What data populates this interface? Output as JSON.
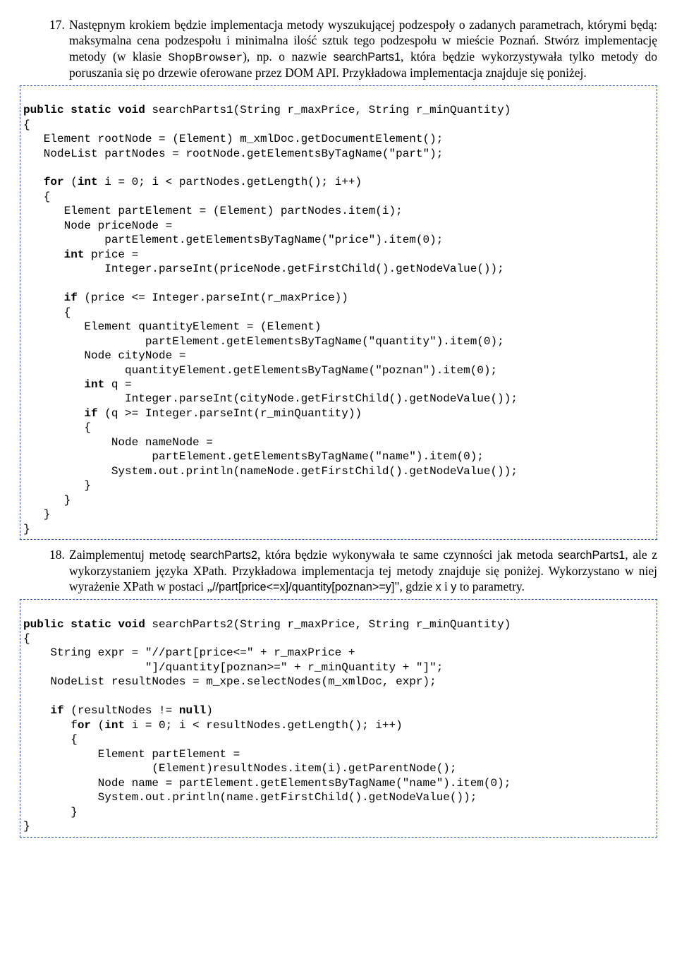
{
  "item17": {
    "num": "17.",
    "p1a": "Następnym krokiem będzie implementacja metody wyszukującej podzespoły o zadanych parametrach, którymi będą: maksymalna cena podzespołu i minimalna ilość sztuk tego podzespołu w mieście Poznań. Stwórz implementację metody (w klasie ",
    "p1b": "ShopBrowser",
    "p1c": "), np. o nazwie ",
    "p1d": "searchParts1",
    "p1e": ", która będzie wykorzystywała tylko metody do poruszania się po drzewie oferowane przez DOM API. Przykładowa implementacja znajduje się poniżej."
  },
  "code1": {
    "l01a": "public static void",
    "l01b": " searchParts1(String r_maxPrice, String r_minQuantity)",
    "l02": "{",
    "l03": "   Element rootNode = (Element) m_xmlDoc.getDocumentElement();",
    "l04": "   NodeList partNodes = rootNode.getElementsByTagName(\"part\");",
    "l05": "",
    "l06a": "   ",
    "l06b": "for",
    "l06c": " (",
    "l06d": "int",
    "l06e": " i = 0; i < partNodes.getLength(); i++)",
    "l07": "   {",
    "l08": "      Element partElement = (Element) partNodes.item(i);",
    "l09": "      Node priceNode =",
    "l10": "            partElement.getElementsByTagName(\"price\").item(0);",
    "l11a": "      ",
    "l11b": "int",
    "l11c": " price =",
    "l12": "            Integer.parseInt(priceNode.getFirstChild().getNodeValue());",
    "l13": "",
    "l14a": "      ",
    "l14b": "if",
    "l14c": " (price <= Integer.parseInt(r_maxPrice))",
    "l15": "      {",
    "l16": "         Element quantityElement = (Element)",
    "l17": "                  partElement.getElementsByTagName(\"quantity\").item(0);",
    "l18": "         Node cityNode =",
    "l19": "               quantityElement.getElementsByTagName(\"poznan\").item(0);",
    "l20a": "         ",
    "l20b": "int",
    "l20c": " q =",
    "l21": "               Integer.parseInt(cityNode.getFirstChild().getNodeValue());",
    "l22a": "         ",
    "l22b": "if",
    "l22c": " (q >= Integer.parseInt(r_minQuantity))",
    "l23": "         {",
    "l24": "             Node nameNode =",
    "l25": "                   partElement.getElementsByTagName(\"name\").item(0);",
    "l26": "             System.out.println(nameNode.getFirstChild().getNodeValue());",
    "l27": "         }",
    "l28": "      }",
    "l29": "   }",
    "l30": "}"
  },
  "item18": {
    "num": "18.",
    "p1a": "Zaimplementuj metodę ",
    "p1b": "searchParts2",
    "p1c": ", która będzie wykonywała te same czynności jak metoda ",
    "p1d": "searchParts1",
    "p1e": ", ale z wykorzystaniem języka XPath. Przykładowa implementacja tej metody znajduje się poniżej. Wykorzystano w niej wyrażenie XPath w postaci „",
    "p1f": "//part[price<=x]/quantity[poznan>=y]",
    "p1g": "\", gdzie ",
    "p1h": "x",
    "p1i": " i ",
    "p1j": "y",
    "p1k": " to parametry."
  },
  "code2": {
    "l01a": "public static void",
    "l01b": " searchParts2(String r_maxPrice, String r_minQuantity)",
    "l02": "{",
    "l03": "    String expr = \"//part[price<=\" + r_maxPrice +",
    "l04": "                  \"]/quantity[poznan>=\" + r_minQuantity + \"]\";",
    "l05": "    NodeList resultNodes = m_xpe.selectNodes(m_xmlDoc, expr);",
    "l06": "",
    "l07a": "    ",
    "l07b": "if",
    "l07c": " (resultNodes != ",
    "l07d": "null",
    "l07e": ")",
    "l08a": "       f",
    "l08b": "or",
    "l08c": " (",
    "l08d": "int",
    "l08e": " i = 0; i < resultNodes.getLength(); i++)",
    "l09": "       {",
    "l10": "           Element partElement =",
    "l11": "                   (Element)resultNodes.item(i).getParentNode();",
    "l12": "           Node name = partElement.getElementsByTagName(\"name\").item(0);",
    "l13": "           System.out.println(name.getFirstChild().getNodeValue());",
    "l14": "       }",
    "l15": "}"
  }
}
